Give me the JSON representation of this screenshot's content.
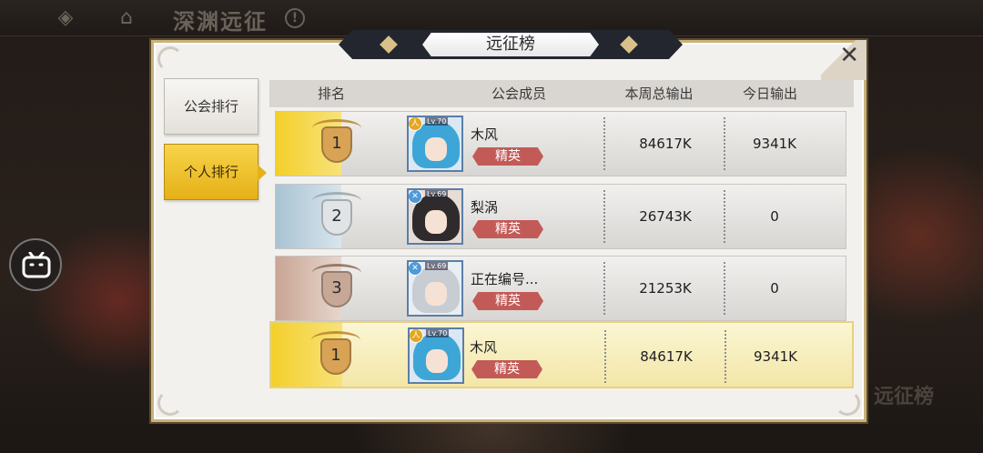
{
  "header": {
    "title": "深渊远征",
    "back_icon": "back-arrow-icon",
    "home_icon": "home-icon",
    "info_icon": "info-icon"
  },
  "side_button_icon": "bilibili-tv-icon",
  "corner_logo": "远征榜",
  "dialog": {
    "title": "远征榜",
    "close_icon": "close-x-icon",
    "tabs": [
      {
        "label": "公会排行",
        "active": false
      },
      {
        "label": "个人排行",
        "active": true
      }
    ],
    "columns": [
      "排名",
      "公会成员",
      "本周总输出",
      "今日输出"
    ],
    "rows": [
      {
        "rank": "1",
        "level": "Lv.70",
        "name": "木风",
        "title": "精英",
        "weekly": "84617K",
        "today": "9341K"
      },
      {
        "rank": "2",
        "level": "Lv.69",
        "name": "梨涡",
        "title": "精英",
        "weekly": "26743K",
        "today": "0"
      },
      {
        "rank": "3",
        "level": "Lv.69",
        "name": "正在编号...",
        "title": "精英",
        "weekly": "21253K",
        "today": "0"
      }
    ],
    "me": {
      "rank": "1",
      "level": "Lv.70",
      "name": "木风",
      "title": "精英",
      "weekly": "84617K",
      "today": "9341K"
    }
  },
  "colors": {
    "gold": "#e6b017",
    "silver": "#a9c3d3",
    "bronze": "#c9a594",
    "tag": "#c25b57"
  }
}
